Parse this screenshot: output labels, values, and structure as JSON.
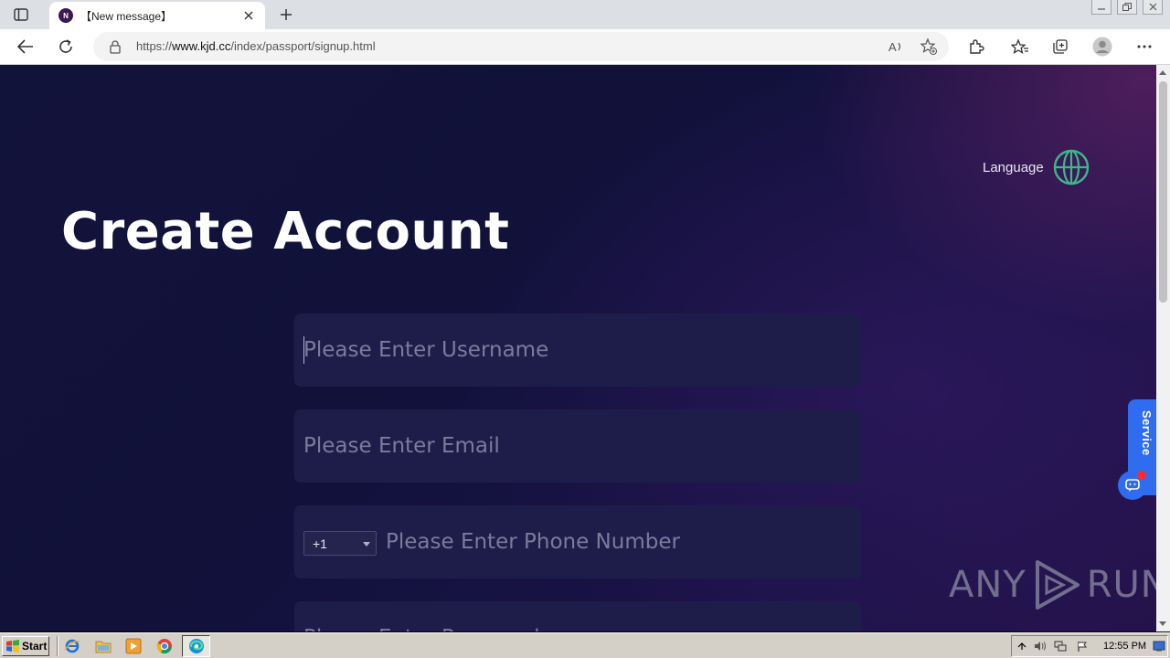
{
  "browser": {
    "tab": {
      "favicon_letter": "N",
      "title": "【New message】"
    },
    "url": {
      "prefix": "https://",
      "domain": "www.kjd.cc",
      "path": "/index/passport/signup.html"
    }
  },
  "page": {
    "language_label": "Language",
    "title": "Create Account",
    "form": {
      "username_placeholder": "Please Enter Username",
      "email_placeholder": "Please Enter Email",
      "country_code": "+1",
      "phone_placeholder": "Please Enter Phone Number",
      "password_placeholder": "Please Enter Password"
    },
    "service_label": "Service"
  },
  "watermark": {
    "left": "ANY",
    "right": "RUN"
  },
  "taskbar": {
    "start_label": "Start",
    "clock": "12:55 PM"
  },
  "colors": {
    "page_bg": "#12133a",
    "field_bg": "#1e1d4a",
    "service_blue": "#2f6cf0",
    "globe_green": "#3fb68b"
  }
}
